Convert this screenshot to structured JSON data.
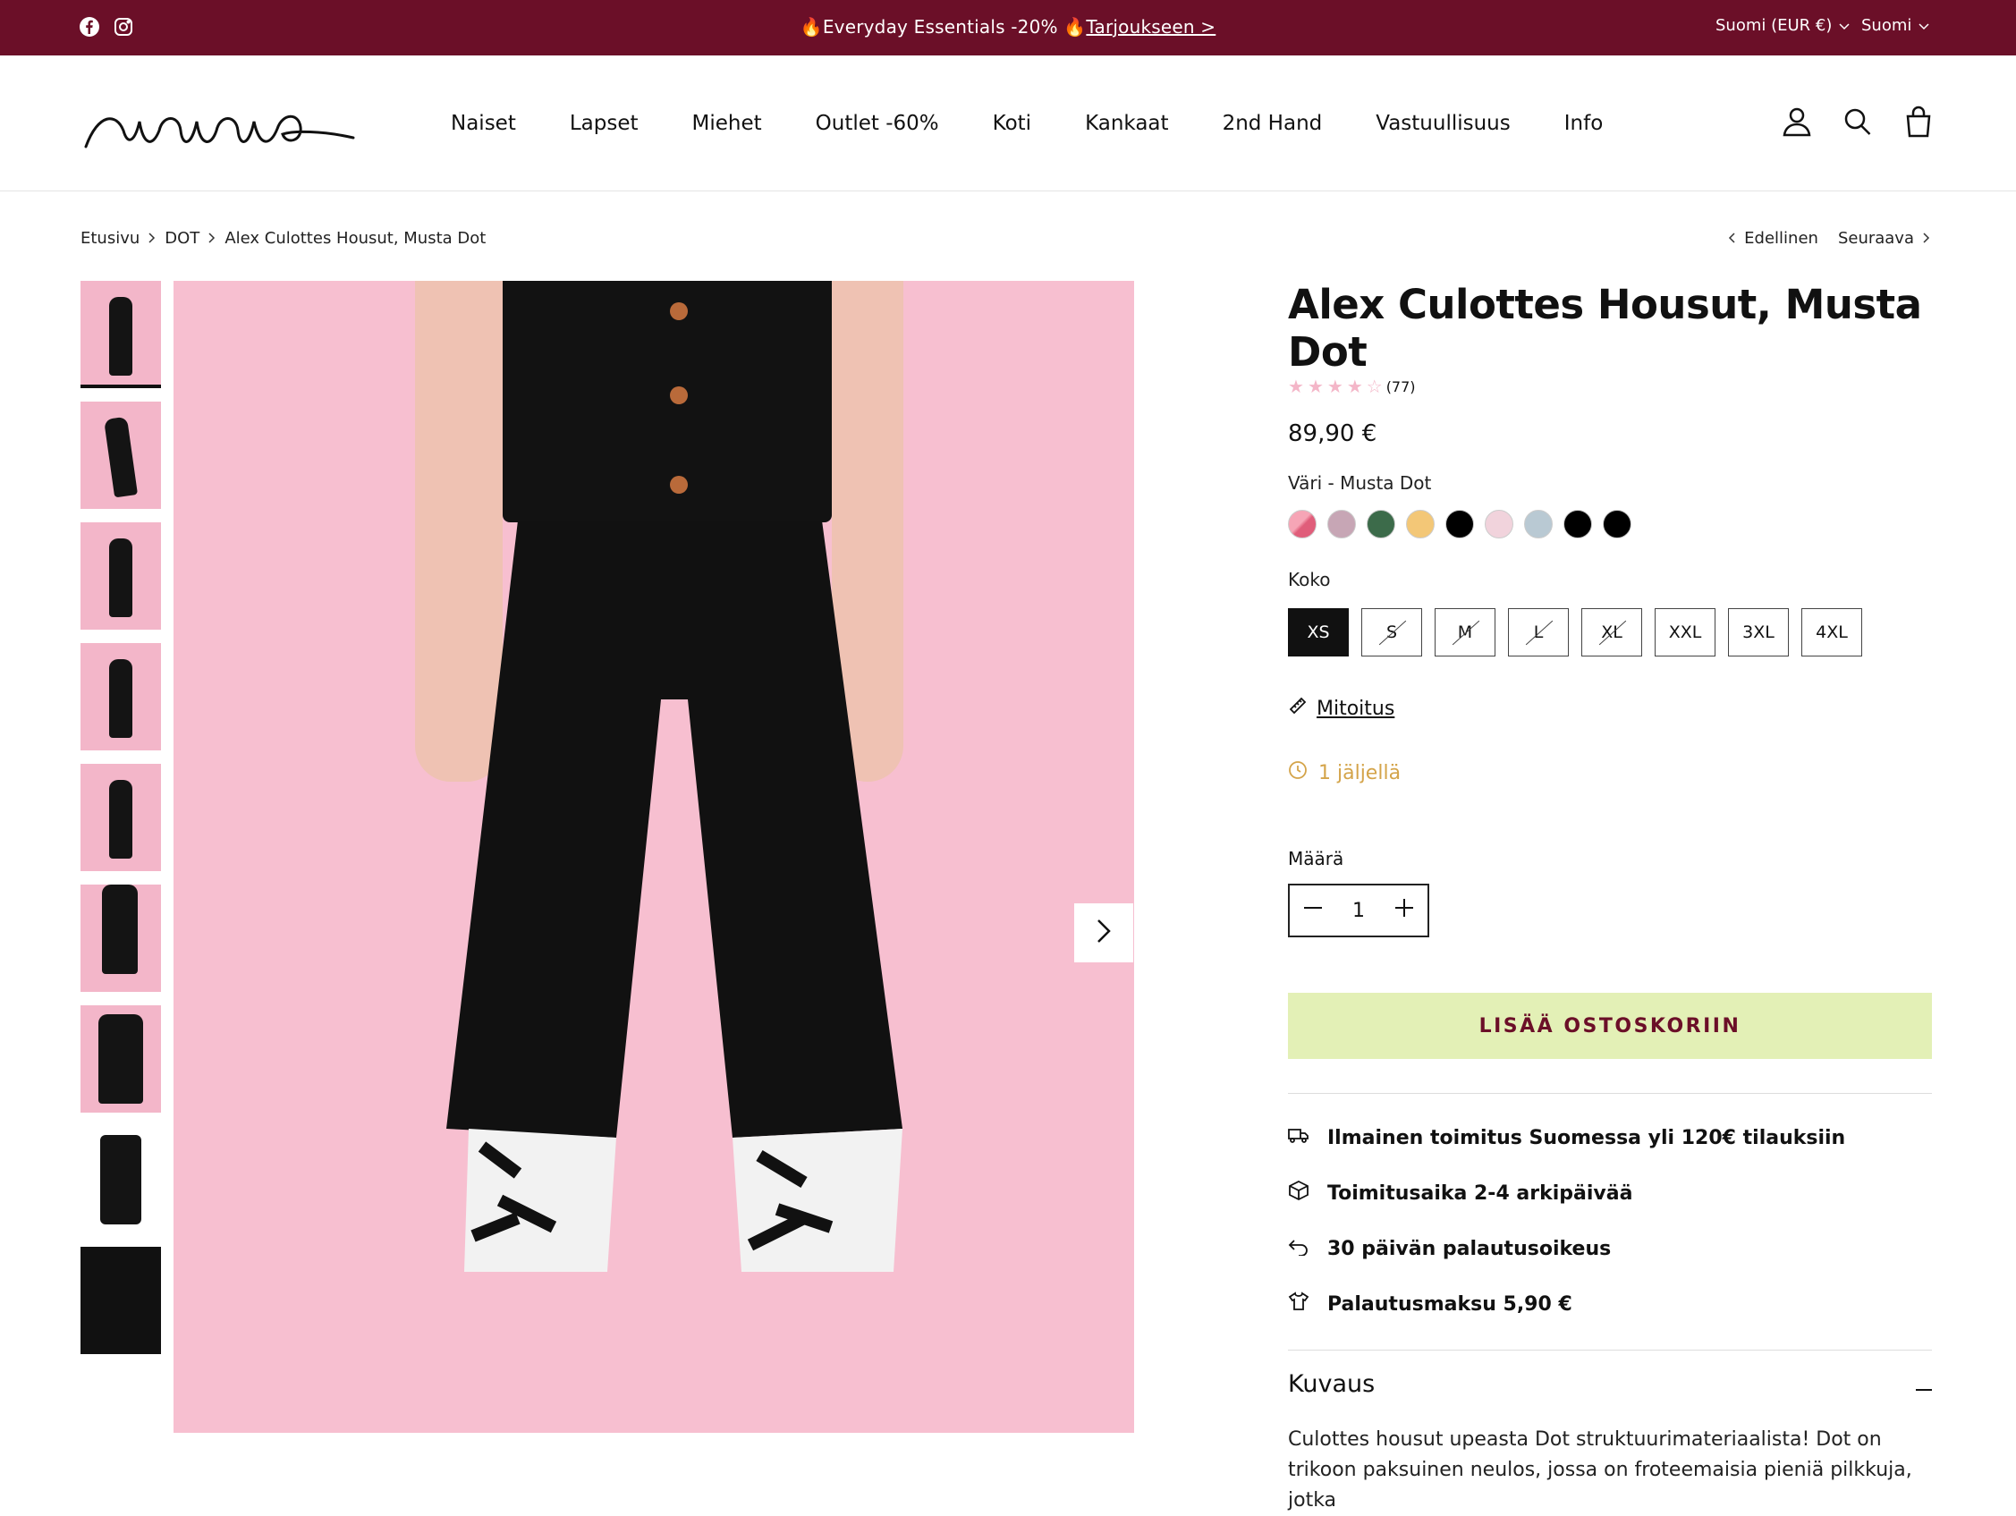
{
  "topbar": {
    "promo_text": "🔥Everyday Essentials -20% 🔥",
    "promo_link": "Tarjoukseen >",
    "currency": "Suomi (EUR €)",
    "language": "Suomi"
  },
  "header": {
    "logo_alt": "Nanso",
    "nav": [
      "Naiset",
      "Lapset",
      "Miehet",
      "Outlet -60%",
      "Koti",
      "Kankaat",
      "2nd Hand",
      "Vastuullisuus",
      "Info"
    ]
  },
  "breadcrumb": [
    "Etusivu",
    "DOT",
    "Alex Culottes Housut, Musta Dot"
  ],
  "pager": {
    "prev": "Edellinen",
    "next": "Seuraava"
  },
  "product": {
    "title": "Alex Culottes Housut, Musta Dot",
    "rating_count": "(77)",
    "rating": 4.5,
    "price": "89,90 €",
    "color_label": "Väri - Musta Dot",
    "swatch_colors": [
      "#f08aa0",
      "#c7a6b5",
      "#3c6b4a",
      "#f3c777",
      "#000000",
      "#f1d3dc",
      "#b9c9d3",
      "#000000",
      "#000000"
    ],
    "size_label": "Koko",
    "sizes": [
      {
        "label": "XS",
        "available": true
      },
      {
        "label": "S",
        "available": false
      },
      {
        "label": "M",
        "available": false
      },
      {
        "label": "L",
        "available": false
      },
      {
        "label": "XL",
        "available": false
      },
      {
        "label": "XXL",
        "available": true
      },
      {
        "label": "3XL",
        "available": true
      },
      {
        "label": "4XL",
        "available": true
      }
    ],
    "size_guide": "Mitoitus",
    "stock": "1 jäljellä",
    "qty_label": "Määrä",
    "qty": "1",
    "add_to_cart": "LISÄÄ OSTOSKORIIN",
    "features": [
      "Ilmainen toimitus Suomessa yli 120€ tilauksiin",
      "Toimitusaika 2-4 arkipäivää",
      "30 päivän palautusoikeus",
      "Palautusmaksu 5,90 €"
    ],
    "description_title": "Kuvaus",
    "description_text": "Culottes housut upeasta Dot struktuurimateriaalista! Dot on trikoon paksuinen neulos, jossa on froteemaisia pieniä pilkkuja, jotka"
  },
  "colors": {
    "brand": "#6b0f28",
    "cta_bg": "#e3f0b6",
    "stock": "#d4a44a",
    "photo_bg": "#f7bfd0"
  }
}
